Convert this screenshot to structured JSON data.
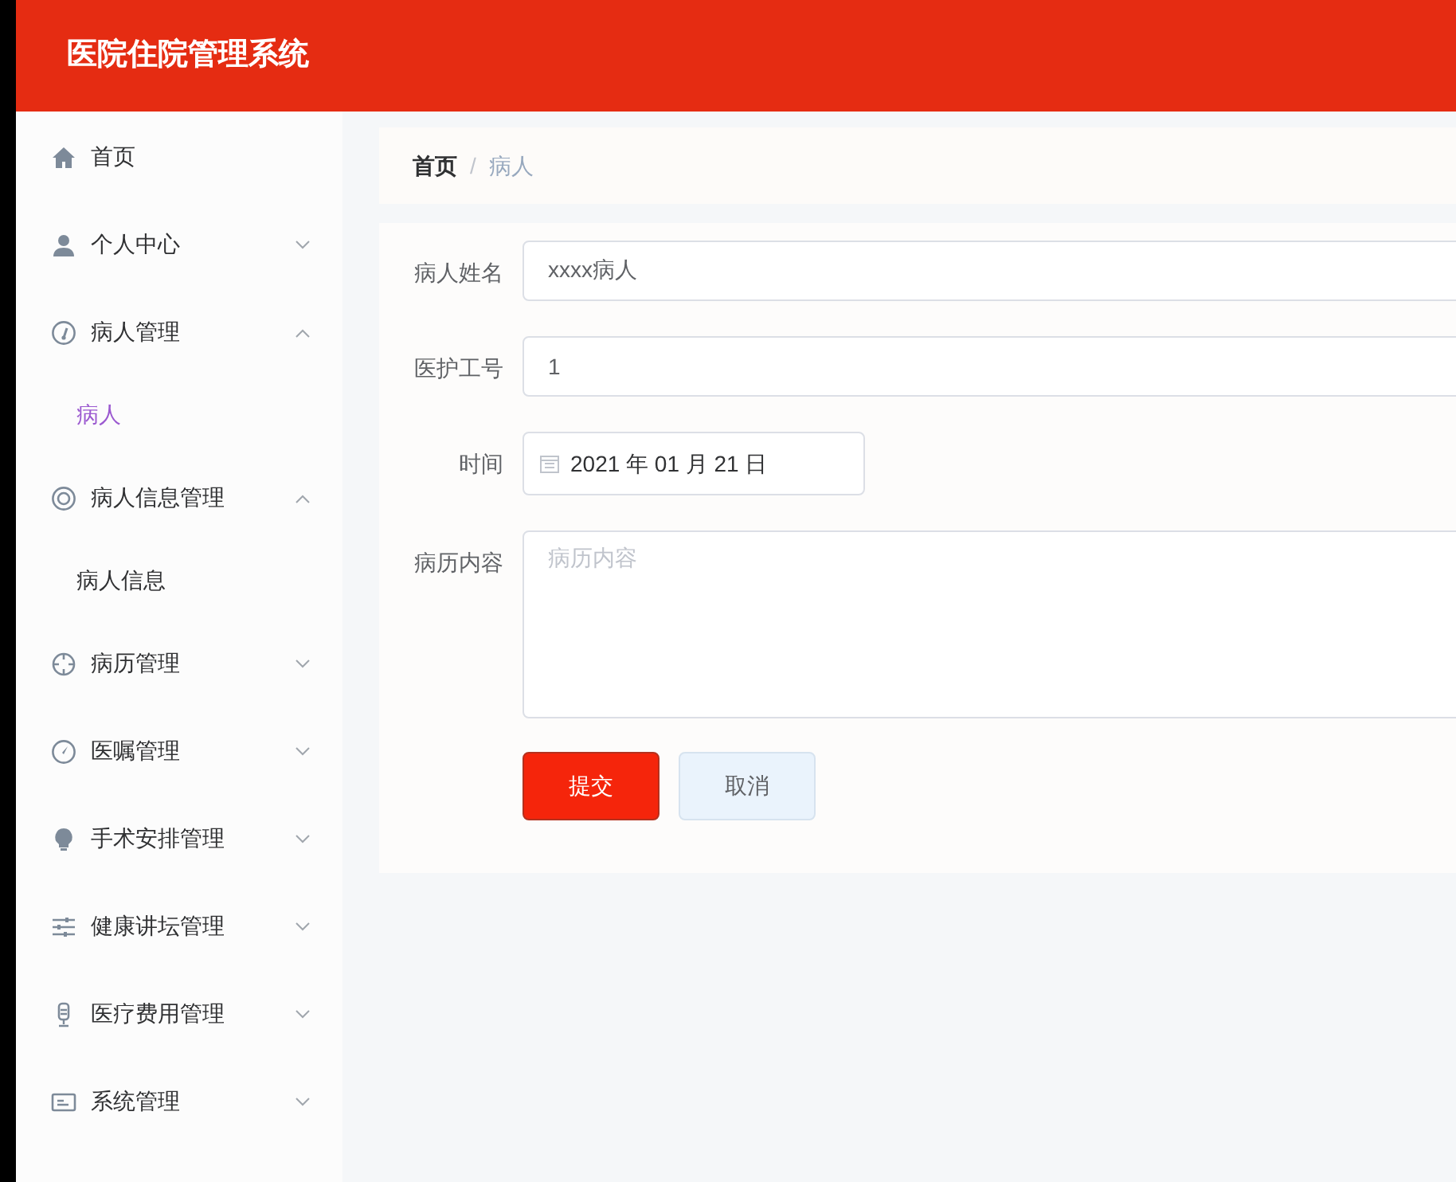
{
  "header": {
    "title": "医院住院管理系统"
  },
  "sidebar": {
    "items": [
      {
        "label": "首页"
      },
      {
        "label": "个人中心",
        "expanded": false
      },
      {
        "label": "病人管理",
        "expanded": true,
        "children": [
          {
            "label": "病人",
            "selected": true
          }
        ]
      },
      {
        "label": "病人信息管理",
        "expanded": true,
        "children": [
          {
            "label": "病人信息",
            "selected": false
          }
        ]
      },
      {
        "label": "病历管理",
        "expanded": false
      },
      {
        "label": "医嘱管理",
        "expanded": false
      },
      {
        "label": "手术安排管理",
        "expanded": false
      },
      {
        "label": "健康讲坛管理",
        "expanded": false
      },
      {
        "label": "医疗费用管理",
        "expanded": false
      },
      {
        "label": "系统管理",
        "expanded": false
      }
    ]
  },
  "breadcrumb": {
    "separator": "/",
    "items": [
      "首页",
      "病人"
    ]
  },
  "form": {
    "fields": [
      {
        "kind": "text",
        "label": "病人姓名",
        "value": "xxxx病人"
      },
      {
        "kind": "text",
        "label": "医护工号",
        "value": "1"
      },
      {
        "kind": "date",
        "label": "时间",
        "value": "2021 年 01 月 21 日"
      },
      {
        "kind": "textarea",
        "label": "病历内容",
        "placeholder": "病历内容"
      }
    ],
    "buttons": [
      {
        "label": "提交",
        "kind": "primary"
      },
      {
        "label": "取消",
        "kind": "secondary"
      }
    ]
  }
}
